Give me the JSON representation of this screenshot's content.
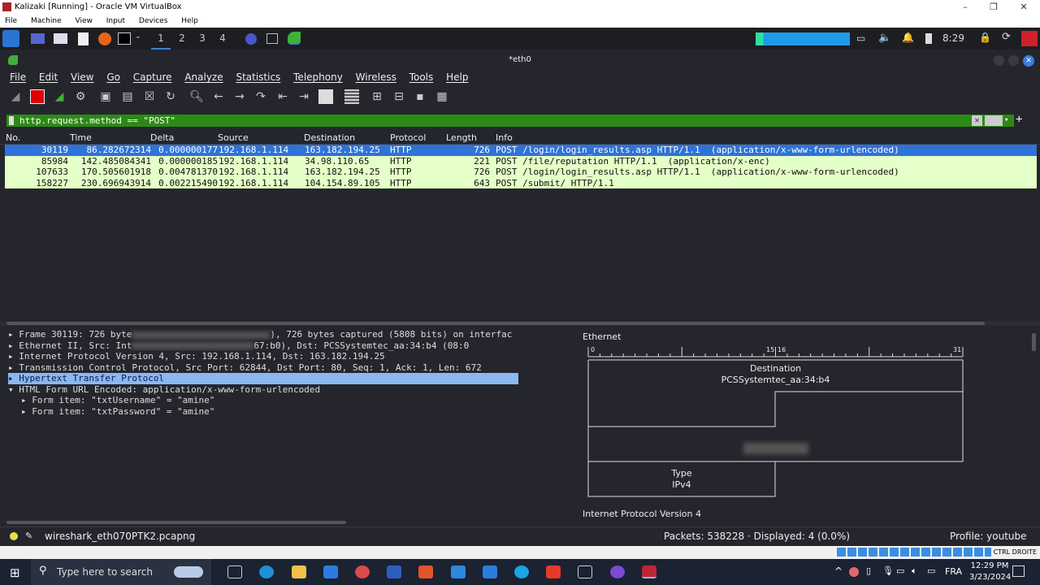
{
  "vbox": {
    "title": "Kalizaki [Running] - Oracle VM VirtualBox",
    "menu": [
      "File",
      "Machine",
      "View",
      "Input",
      "Devices",
      "Help"
    ],
    "status_key": "CTRL DROITE"
  },
  "kali_panel": {
    "workspaces": [
      "1",
      "2",
      "3",
      "4"
    ],
    "clock": "8:29"
  },
  "wireshark": {
    "title": "*eth0",
    "menu": [
      "File",
      "Edit",
      "View",
      "Go",
      "Capture",
      "Analyze",
      "Statistics",
      "Telephony",
      "Wireless",
      "Tools",
      "Help"
    ],
    "filter": "http.request.method == \"POST\"",
    "columns": [
      "No.",
      "Time",
      "Delta",
      "Source",
      "Destination",
      "Protocol",
      "Length",
      "Info"
    ],
    "packets": [
      {
        "no": "30119",
        "time": "86.282672314",
        "delta": "0.000000177",
        "src": "192.168.1.114",
        "dst": "163.182.194.25",
        "proto": "HTTP",
        "len": "726",
        "info": "POST /login/login_results.asp HTTP/1.1  (application/x-www-form-urlencoded)",
        "selected": true
      },
      {
        "no": "85984",
        "time": "142.485084341",
        "delta": "0.000000185",
        "src": "192.168.1.114",
        "dst": "34.98.110.65",
        "proto": "HTTP",
        "len": "221",
        "info": "POST /file/reputation HTTP/1.1  (application/x-enc)"
      },
      {
        "no": "107633",
        "time": "170.505601918",
        "delta": "0.004781370",
        "src": "192.168.1.114",
        "dst": "163.182.194.25",
        "proto": "HTTP",
        "len": "726",
        "info": "POST /login/login_results.asp HTTP/1.1  (application/x-www-form-urlencoded)"
      },
      {
        "no": "158227",
        "time": "230.696943914",
        "delta": "0.002215490",
        "src": "192.168.1.114",
        "dst": "104.154.89.105",
        "proto": "HTTP",
        "len": "643",
        "info": "POST /submit/ HTTP/1.1"
      }
    ],
    "details": {
      "frame_a": "Frame 30119: 726 byte",
      "frame_b": "), 726 bytes captured (5808 bits) on interfac",
      "eth_a": "Ethernet II, Src: Int",
      "eth_b": "67:b0), Dst: PCSSystemtec_aa:34:b4 (08:0",
      "ip": "Internet Protocol Version 4, Src: 192.168.1.114, Dst: 163.182.194.25",
      "tcp": "Transmission Control Protocol, Src Port: 62844, Dst Port: 80, Seq: 1, Ack: 1, Len: 672",
      "http": "Hypertext Transfer Protocol",
      "form": "HTML Form URL Encoded: application/x-www-form-urlencoded",
      "item1": "Form item: \"txtUsername\" = \"amine\"",
      "item2": "Form item: \"txtPassword\" = \"amine\""
    },
    "diagram": {
      "title": "Ethernet",
      "ticks": [
        "0",
        "15",
        "16",
        "31"
      ],
      "dest_label": "Destination",
      "dest_value": "PCSSystemtec_aa:34:b4",
      "type_label": "Type",
      "type_value": "IPv4",
      "next_title": "Internet Protocol Version 4"
    },
    "status": {
      "file": "wireshark_eth070PTK2.pcapng",
      "packets": "Packets: 538228 · Displayed: 4 (0.0%)",
      "profile": "Profile: youtube"
    }
  },
  "taskbar": {
    "search_placeholder": "Type here to search",
    "lang": "FRA",
    "time": "12:29 PM",
    "date": "3/23/2024"
  },
  "colors": {
    "filter_ok": "#2c8a14",
    "row_match": "#e4ffc7",
    "row_selected": "#2f73d8",
    "highlight": "#8ab8ef"
  }
}
